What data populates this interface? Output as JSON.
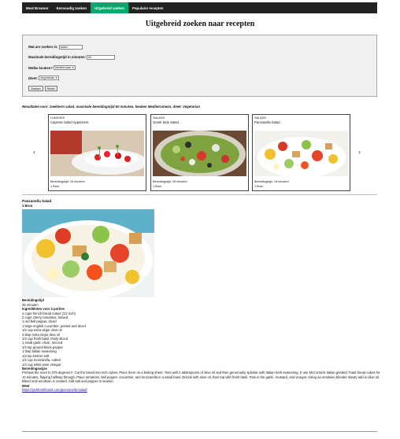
{
  "nav": {
    "items": [
      "Meal Browser",
      "Eenvoudig zoeken",
      "Uitgebreid zoeken",
      "Populaire recepten"
    ],
    "active_index": 2,
    "active_color": "#04AA6D"
  },
  "page_title": "Uitgebreid zoeken naar recepten",
  "form": {
    "ingredient_label": "Wat are zoeken in:",
    "ingredient_value": "salad",
    "time_label": "Maximale bereidingstijd in minuten:",
    "time_value": "60",
    "cuisine_label": "Welke keuken?",
    "cuisine_value": "Mediterraan",
    "diet_label": "Dieet:",
    "diet_value": "Vegetarian",
    "search_button": "Zoeken",
    "reset_button": "Reset"
  },
  "summary": "Resultaten voor: zoekterm salad, maximale bereidingstijd 60 minuten, keuken Mediterranean, dieet: Vegetarian",
  "cards": [
    {
      "category": "LUNCHES",
      "name": "Caprese Salad Appetizers",
      "time": "Bereidingstijd: 15 minuten",
      "source": "1 Bron"
    },
    {
      "category": "SALADS",
      "name": "Greek Side Salad",
      "time": "Bereidingstijd: 25 minuten",
      "source": "1 Bron"
    },
    {
      "category": "SALADS",
      "name": "Panzanella Salad",
      "time": "Bereidingstijd: 15 minuten",
      "source": "1 Bron"
    }
  ],
  "carousel": {
    "prev": "‹",
    "next": "›"
  },
  "detail": {
    "title": "Panzanella Salad",
    "source": "1 Bron",
    "time_heading": "Bereidingstijd",
    "time_value": "45 minuten",
    "ingredients_heading": "Ingrediënten voor 4 porties",
    "ingredients": [
      "4 cups french bread cubes (1/2 inch)",
      "2 cups cherry tomatoes, halved",
      "1 red bell pepper, diced",
      "1 large english cucumber, peeled and diced",
      "1/2 cup extra virgin olive oil",
      "2 tbsp extra virgin olive oil",
      "1/2 cup fresh basil, thinly sliced",
      "1 small garlic clove, minced",
      "1/2 tsp ground black pepper",
      "1 tbsp italian seasoning",
      "1/2 tsp kosher salt",
      "1/2 cup mozzarella, cubed",
      "1/4 cup white wine vinegar"
    ],
    "prep_heading": "Bereidingswijze",
    "prep_text": "Preheat the oven to 375 degrees F. Cut the bread into inch cubes. Place them on a baking sheet. Toss with 2 tablespoons of olive oil and then generously sprinkle with Italian herb seasoning. (I use McCormick Italian grinder) Toast bread cubes for 10 minutes, flipping halfway through. Place tomatoes, bell pepper, cucumber, and mozzarella in a salad bowl. Drizzle with olive oil, then top with fresh basil. Toss in the garlic, mustard, and vinegar. Using an emulsion blender slowly add in olive oil. Blend until emulsion is created. Add salt and pepper to season.",
    "link_heading": "Meer",
    "link_text": "https://pickfreshfoods.com/panzanella-salad/"
  }
}
